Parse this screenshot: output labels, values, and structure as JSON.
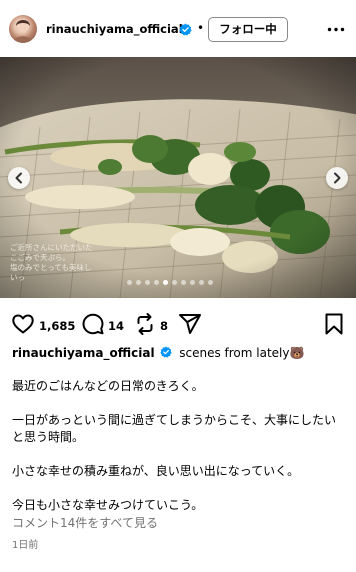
{
  "header": {
    "username": "rinauchiyama_official",
    "separator": "•",
    "follow_button": "フォロー中",
    "more_icon": "more-horizontal-icon",
    "verified_icon": "verified-badge-icon"
  },
  "photo": {
    "overlay_text": "ご近所さんにいただいた\nこごみで天ぷら。\n塩のみでとっても美味し\nいっ",
    "prev_icon": "chevron-left-icon",
    "next_icon": "chevron-right-icon",
    "carousel": {
      "total": 10,
      "current": 5
    }
  },
  "actions": {
    "likes": "1,685",
    "comments": "14",
    "reposts": "8",
    "like_icon": "heart-icon",
    "comment_icon": "comment-icon",
    "repost_icon": "repost-icon",
    "share_icon": "send-icon",
    "save_icon": "bookmark-icon"
  },
  "caption": {
    "username": "rinauchiyama_official",
    "text": "scenes from lately🐻",
    "body": "最近のごはんなどの日常のきろく。\n\n一日があっという間に過ぎてしまうからこそ、大事にしたいと思う時間。\n\n小さな幸せの積み重ねが、良い思い出になっていく。\n\n今日も小さな幸せみつけていこう。"
  },
  "comments_link": "コメント14件をすべて見る",
  "timestamp": "1日前",
  "colors": {
    "verified": "#0095f6",
    "muted": "#737373",
    "text": "#000000"
  }
}
